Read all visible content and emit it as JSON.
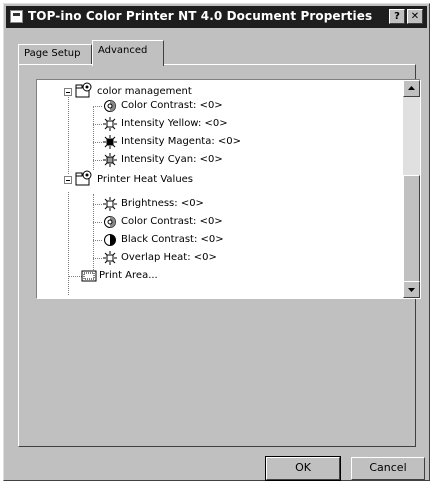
{
  "window": {
    "title": "TOP-ino Color Printer NT 4.0 Document Properties",
    "help_label": "?",
    "close_label": "✕"
  },
  "tabs": [
    {
      "label": "Page Setup",
      "selected": false
    },
    {
      "label": "Advanced",
      "selected": true
    }
  ],
  "tree": {
    "items": [
      {
        "label": "color management",
        "icon": "settings-folder-icon"
      },
      {
        "label": "Color Contrast: <0>",
        "icon": "contrast-dial-icon"
      },
      {
        "label": "Intensity Yellow: <0>",
        "icon": "sun-icon"
      },
      {
        "label": "Intensity Magenta: <0>",
        "icon": "sun-icon"
      },
      {
        "label": "Intensity Cyan: <0>",
        "icon": "sun-icon"
      },
      {
        "label": "Printer Heat Values",
        "icon": "settings-folder-icon"
      },
      {
        "label": "Brightness: <0>",
        "icon": "sun-icon"
      },
      {
        "label": "Color Contrast: <0>",
        "icon": "contrast-dial-icon"
      },
      {
        "label": "Black Contrast: <0>",
        "icon": "black-contrast-icon"
      },
      {
        "label": "Overlap Heat: <0>",
        "icon": "sun-icon"
      },
      {
        "label": "Print Area...",
        "icon": "print-area-icon"
      }
    ]
  },
  "buttons": {
    "ok": "OK",
    "cancel": "Cancel"
  }
}
